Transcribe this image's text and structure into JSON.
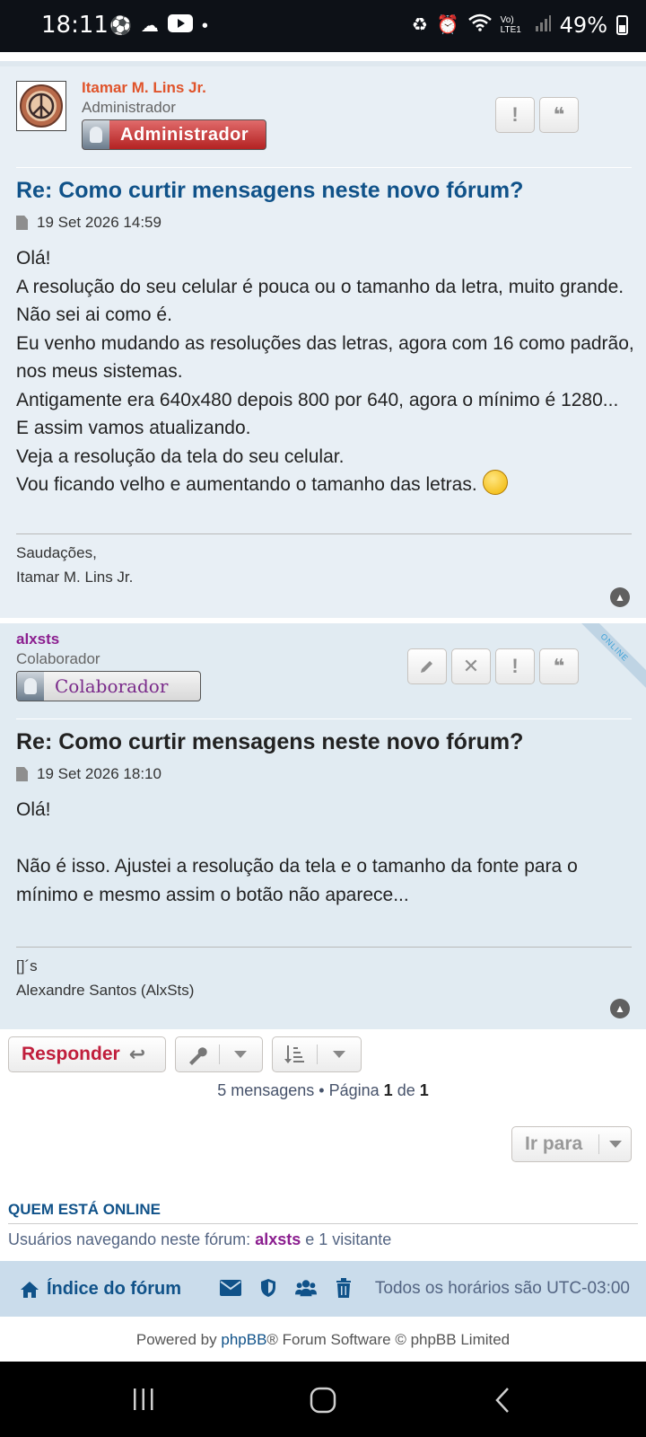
{
  "status_bar": {
    "time": "18:11",
    "battery": "49%",
    "network": "Vo) LTE1"
  },
  "post1": {
    "username": "Itamar M. Lins Jr.",
    "rank": "Administrador",
    "rank_badge": "Administrador",
    "title": "Re: Como curtir mensagens neste novo fórum?",
    "time": "19 Set 2026 14:59",
    "body": [
      "Olá!",
      "A resolução do seu celular é pouca ou o tamanho da letra, muito grande. Não sei ai como é.",
      "Eu venho mudando as resoluções das letras, agora com 16 como padrão, nos meus sistemas.",
      "Antigamente era 640x480 depois 800 por 640, agora o mínimo é 1280... E assim vamos atualizando.",
      "Veja a resolução da tela do seu celular.",
      "Vou ficando velho e aumentando o tamanho das letras."
    ],
    "signature": [
      "Saudações,",
      "Itamar M. Lins Jr."
    ],
    "colors": {
      "username": "#e0542b",
      "title": "#105289"
    }
  },
  "post2": {
    "username": "alxsts",
    "rank": "Colaborador",
    "rank_badge": "Colaborador",
    "online_label": "ONLINE",
    "title": "Re: Como curtir mensagens neste novo fórum?",
    "time": "19 Set 2026 18:10",
    "body": [
      "Olá!",
      "",
      "Não é isso. Ajustei a resolução da tela e o tamanho da fonte para o mínimo e mesmo assim o botão não aparece..."
    ],
    "signature": [
      "[]´s",
      "Alexandre Santos (AlxSts)"
    ],
    "colors": {
      "username": "#8b1e8f",
      "title": "#222222"
    }
  },
  "actions": {
    "reply_label": "Responder",
    "pagination_prefix": "5 mensagens • Página",
    "page_current": "1",
    "page_of": "de",
    "page_total": "1",
    "goto_label": "Ir para"
  },
  "who_online": {
    "title": "QUEM ESTÁ ONLINE",
    "text_prefix": "Usuários navegando neste fórum:",
    "user": "alxsts",
    "text_suffix": "e 1 visitante"
  },
  "navbar": {
    "home_label": "Índice do fórum",
    "timezone": "Todos os horários são UTC-03:00"
  },
  "footer": {
    "prefix": "Powered by",
    "link": "phpBB",
    "suffix": "® Forum Software © phpBB Limited"
  }
}
